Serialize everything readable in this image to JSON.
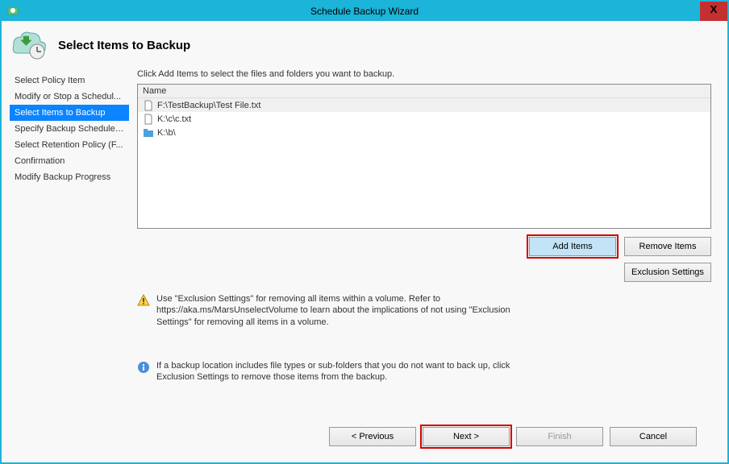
{
  "window": {
    "title": "Schedule Backup Wizard",
    "close_label": "X"
  },
  "header": {
    "page_title": "Select Items to Backup"
  },
  "sidebar": {
    "items": [
      {
        "label": "Select Policy Item"
      },
      {
        "label": "Modify or Stop a Schedul..."
      },
      {
        "label": "Select Items to Backup"
      },
      {
        "label": "Specify Backup Schedule ..."
      },
      {
        "label": "Select Retention Policy (F..."
      },
      {
        "label": "Confirmation"
      },
      {
        "label": "Modify Backup Progress"
      }
    ],
    "selected_index": 2
  },
  "main": {
    "instruction": "Click Add Items to select the files and folders you want to backup.",
    "list_header": "Name",
    "items": [
      {
        "icon": "file",
        "label": "F:\\TestBackup\\Test File.txt"
      },
      {
        "icon": "file",
        "label": "K:\\c\\c.txt"
      },
      {
        "icon": "folder",
        "label": "K:\\b\\"
      }
    ],
    "buttons": {
      "add_items": "Add Items",
      "remove_items": "Remove Items",
      "exclusion_settings": "Exclusion Settings"
    },
    "warning_text": "Use \"Exclusion Settings\" for removing all items within a volume. Refer to https://aka.ms/MarsUnselectVolume to learn about the implications of not using \"Exclusion Settings\" for removing all items in a volume.",
    "info_text": "If a backup location includes file types or sub-folders that you do not want to back up, click Exclusion Settings to remove those items from the backup."
  },
  "footer": {
    "previous": "< Previous",
    "next": "Next >",
    "finish": "Finish",
    "cancel": "Cancel"
  }
}
